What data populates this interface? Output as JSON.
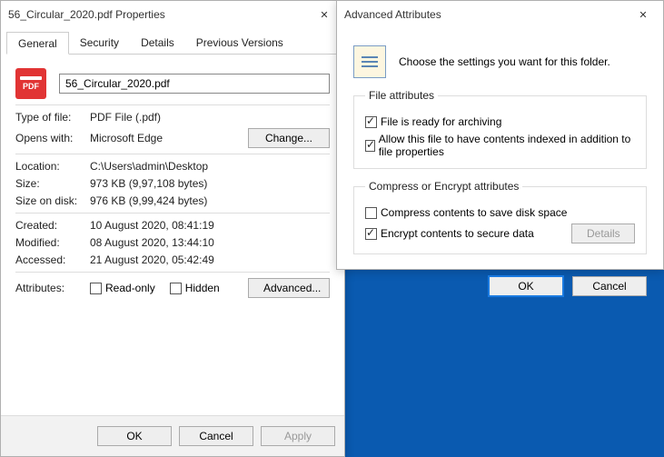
{
  "properties": {
    "title": "56_Circular_2020.pdf Properties",
    "tabs": {
      "general": "General",
      "security": "Security",
      "details": "Details",
      "prev": "Previous Versions"
    },
    "filename": "56_Circular_2020.pdf",
    "type_label": "Type of file:",
    "type_value": "PDF File (.pdf)",
    "opens_label": "Opens with:",
    "opens_value": "Microsoft Edge",
    "change_btn": "Change...",
    "location_label": "Location:",
    "location_value": "C:\\Users\\admin\\Desktop",
    "size_label": "Size:",
    "size_value": "973 KB (9,97,108 bytes)",
    "disk_label": "Size on disk:",
    "disk_value": "976 KB (9,99,424 bytes)",
    "created_label": "Created:",
    "created_value": "10 August 2020, 08:41:19",
    "modified_label": "Modified:",
    "modified_value": "08 August 2020, 13:44:10",
    "accessed_label": "Accessed:",
    "accessed_value": "21 August 2020, 05:42:49",
    "attributes_label": "Attributes:",
    "readonly_label": "Read-only",
    "hidden_label": "Hidden",
    "advanced_btn": "Advanced...",
    "ok": "OK",
    "cancel": "Cancel",
    "apply": "Apply"
  },
  "advanced": {
    "title": "Advanced Attributes",
    "intro": "Choose the settings you want for this folder.",
    "file_attr_legend": "File attributes",
    "ready_label": "File is ready for archiving",
    "index_label": "Allow this file to have contents indexed in addition to file properties",
    "compress_legend": "Compress or Encrypt attributes",
    "compress_label": "Compress contents to save disk space",
    "encrypt_label": "Encrypt contents to secure data",
    "details_btn": "Details",
    "ok": "OK",
    "cancel": "Cancel"
  }
}
